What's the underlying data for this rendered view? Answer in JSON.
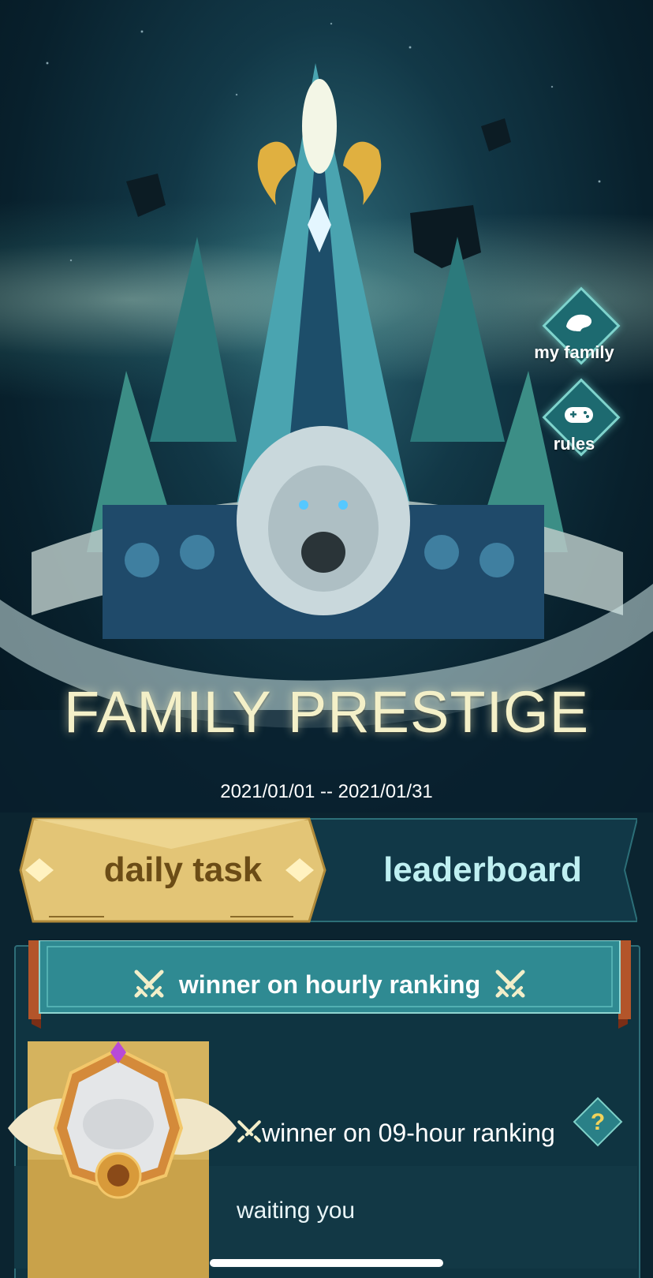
{
  "hero": {
    "title": "FAMILY PRESTIGE",
    "dates": "2021/01/01 -- 2021/01/31"
  },
  "side_buttons": {
    "my_family": {
      "label": "my family",
      "icon": "lion-icon"
    },
    "rules": {
      "label": "rules",
      "icon": "gamepad-icon"
    }
  },
  "tabs": [
    {
      "label": "daily task",
      "active": true
    },
    {
      "label": "leaderboard",
      "active": false
    }
  ],
  "section": {
    "title": "winner on hourly ranking",
    "icon": "crossed-swords-icon"
  },
  "entry": {
    "title": "winner on 09-hour ranking",
    "status": "waiting you",
    "help_icon": "question-mark-icon",
    "help_glyph": "?"
  },
  "colors": {
    "accent_gold": "#e8c876",
    "teal": "#2f8a92",
    "panel": "#0f3441"
  }
}
